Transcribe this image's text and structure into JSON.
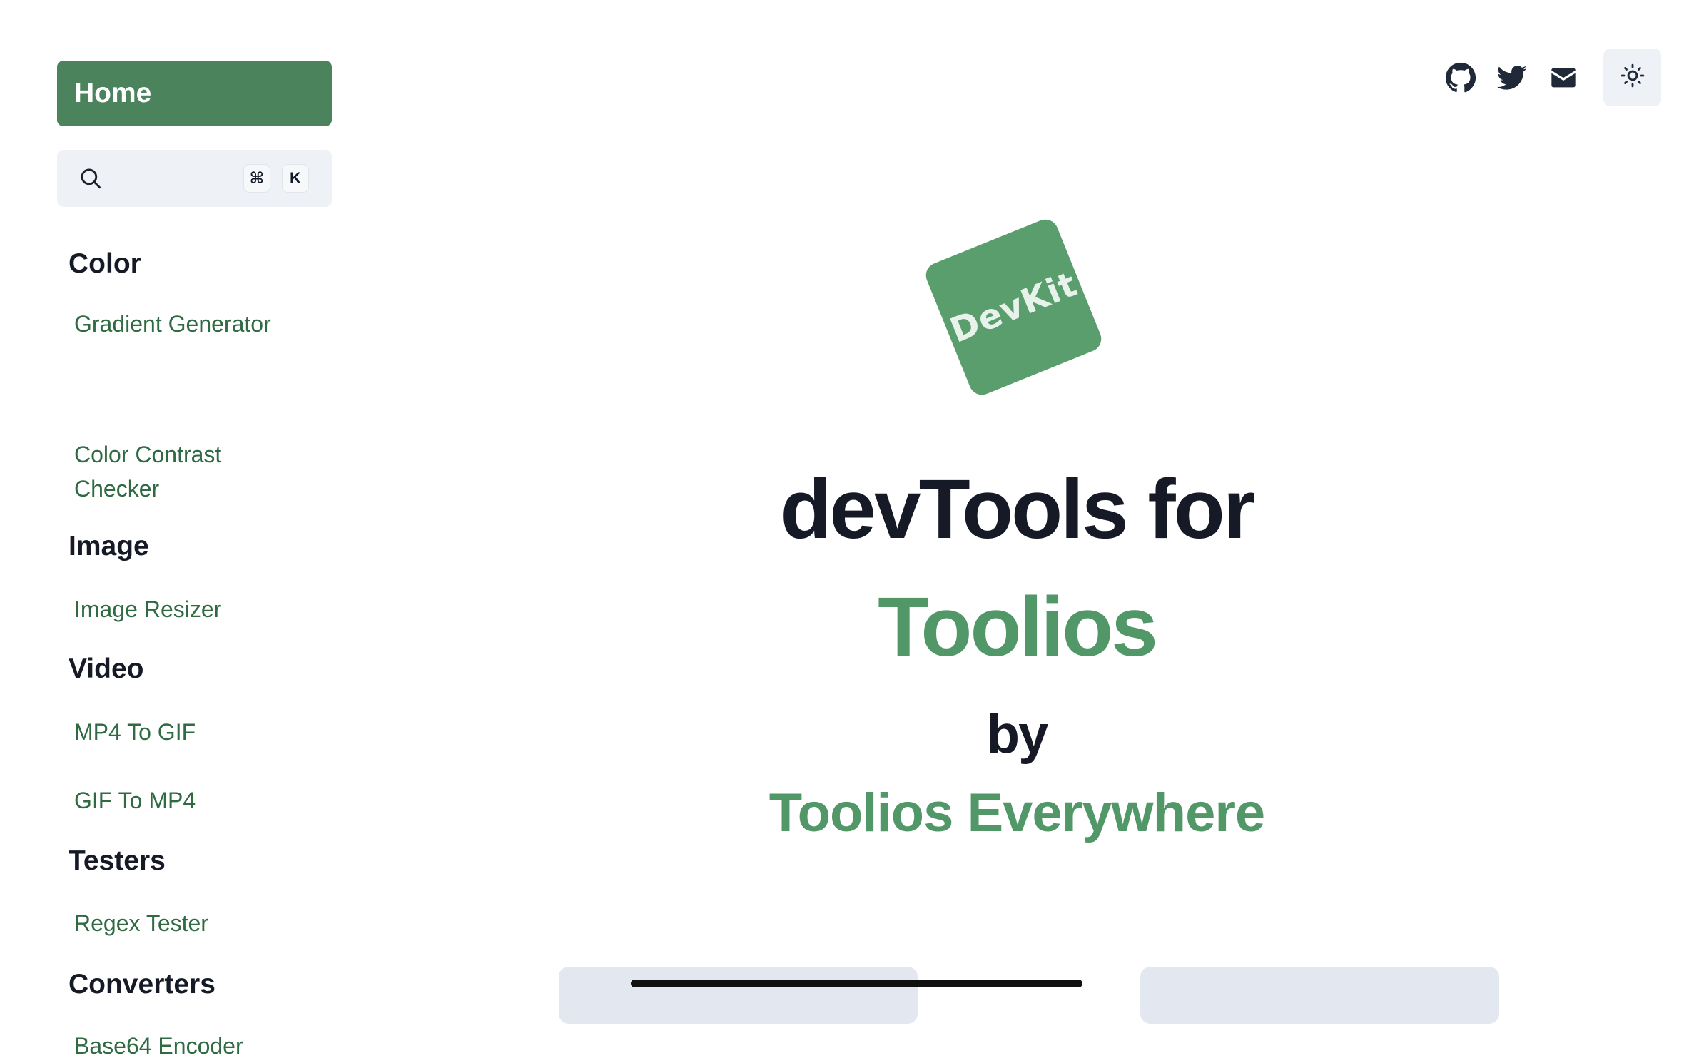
{
  "sidebar": {
    "home_label": "Home",
    "search": {
      "placeholder": "",
      "shortcut_keys": [
        "⌘",
        "K"
      ]
    },
    "sections": [
      {
        "title": "Color",
        "items": [
          "Gradient Generator",
          "Color Contrast Checker"
        ]
      },
      {
        "title": "Image",
        "items": [
          "Image Resizer"
        ]
      },
      {
        "title": "Video",
        "items": [
          "MP4 To GIF",
          "GIF To MP4"
        ]
      },
      {
        "title": "Testers",
        "items": [
          "Regex Tester"
        ]
      },
      {
        "title": "Converters",
        "items": [
          "Base64 Encoder"
        ]
      }
    ]
  },
  "header": {
    "icons": [
      "github-icon",
      "twitter-icon",
      "mail-icon"
    ],
    "theme_toggle_icon": "sun-icon"
  },
  "hero": {
    "logo_text": "DevKit",
    "line1": "devTools for",
    "line2": "Toolios",
    "line3": "by",
    "line4": "Toolios Everywhere"
  },
  "colors": {
    "accent": "#4b845c",
    "accent_text": "#519767",
    "link": "#2f6a43",
    "heading": "#161a26"
  }
}
